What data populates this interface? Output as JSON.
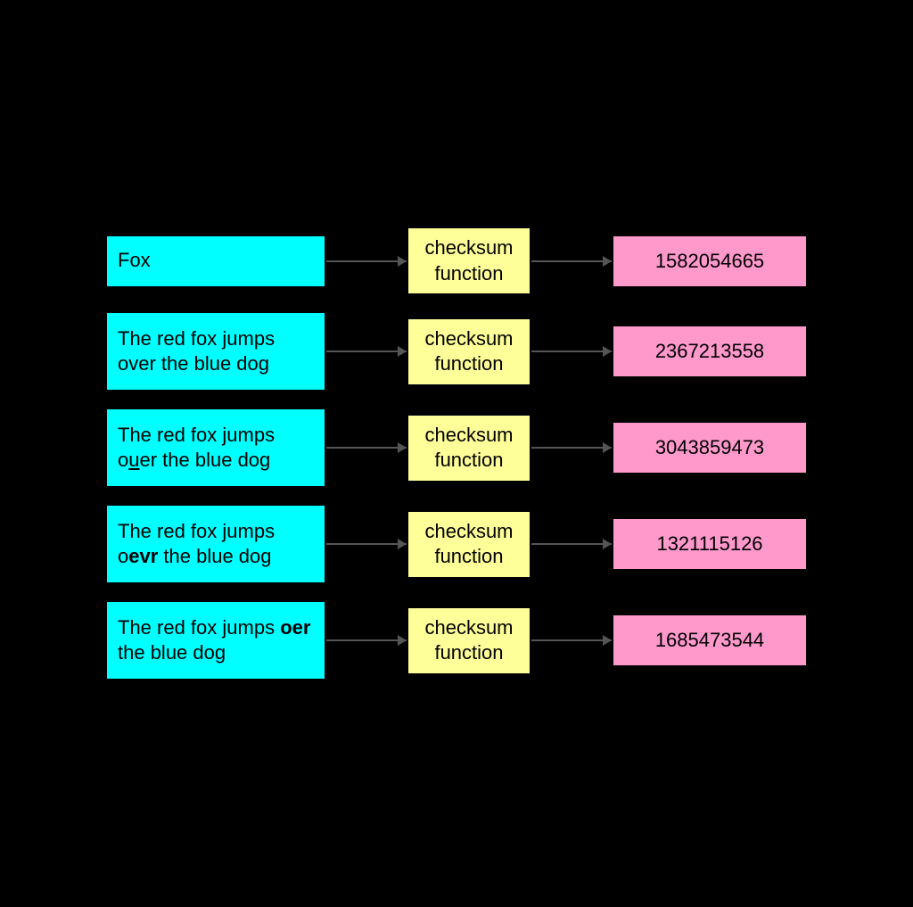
{
  "rows": [
    {
      "id": "row-fox",
      "input_text_plain": "Fox",
      "input_html": "Fox",
      "function_label": "checksum\nfunction",
      "output_value": "1582054665",
      "single_line": true
    },
    {
      "id": "row-full",
      "input_text_plain": "The red fox jumps over the blue dog",
      "input_html": "The red fox jumps over\nthe blue dog",
      "function_label": "checksum\nfunction",
      "output_value": "2367213558",
      "single_line": false
    },
    {
      "id": "row-ouer",
      "input_text_plain": "The red fox jumps ouer the blue dog",
      "input_html_parts": [
        {
          "text": "The red fox jumps o",
          "style": "normal"
        },
        {
          "text": "u",
          "style": "underline"
        },
        {
          "text": "er\nthe blue dog",
          "style": "normal"
        }
      ],
      "function_label": "checksum\nfunction",
      "output_value": "3043859473",
      "single_line": false
    },
    {
      "id": "row-oevr",
      "input_text_plain": "The red fox jumps oevr the blue dog",
      "input_html_parts": [
        {
          "text": "The red fox jumps o",
          "style": "normal"
        },
        {
          "text": "evr",
          "style": "bold"
        },
        {
          "text": "\nthe blue dog",
          "style": "normal"
        }
      ],
      "function_label": "checksum\nfunction",
      "output_value": "1321115126",
      "single_line": false
    },
    {
      "id": "row-oer",
      "input_text_plain": "The red fox jumps oer the blue dog",
      "input_html_parts": [
        {
          "text": "The red fox jumps ",
          "style": "normal"
        },
        {
          "text": "oer",
          "style": "bold"
        },
        {
          "text": "\nthe blue dog",
          "style": "normal"
        }
      ],
      "function_label": "checksum\nfunction",
      "output_value": "1685473544",
      "single_line": false
    }
  ],
  "connector_color": "#777",
  "colors": {
    "input_bg": "#00FFFF",
    "function_bg": "#FFFF99",
    "output_bg": "#FF99CC",
    "bg": "#000000"
  }
}
